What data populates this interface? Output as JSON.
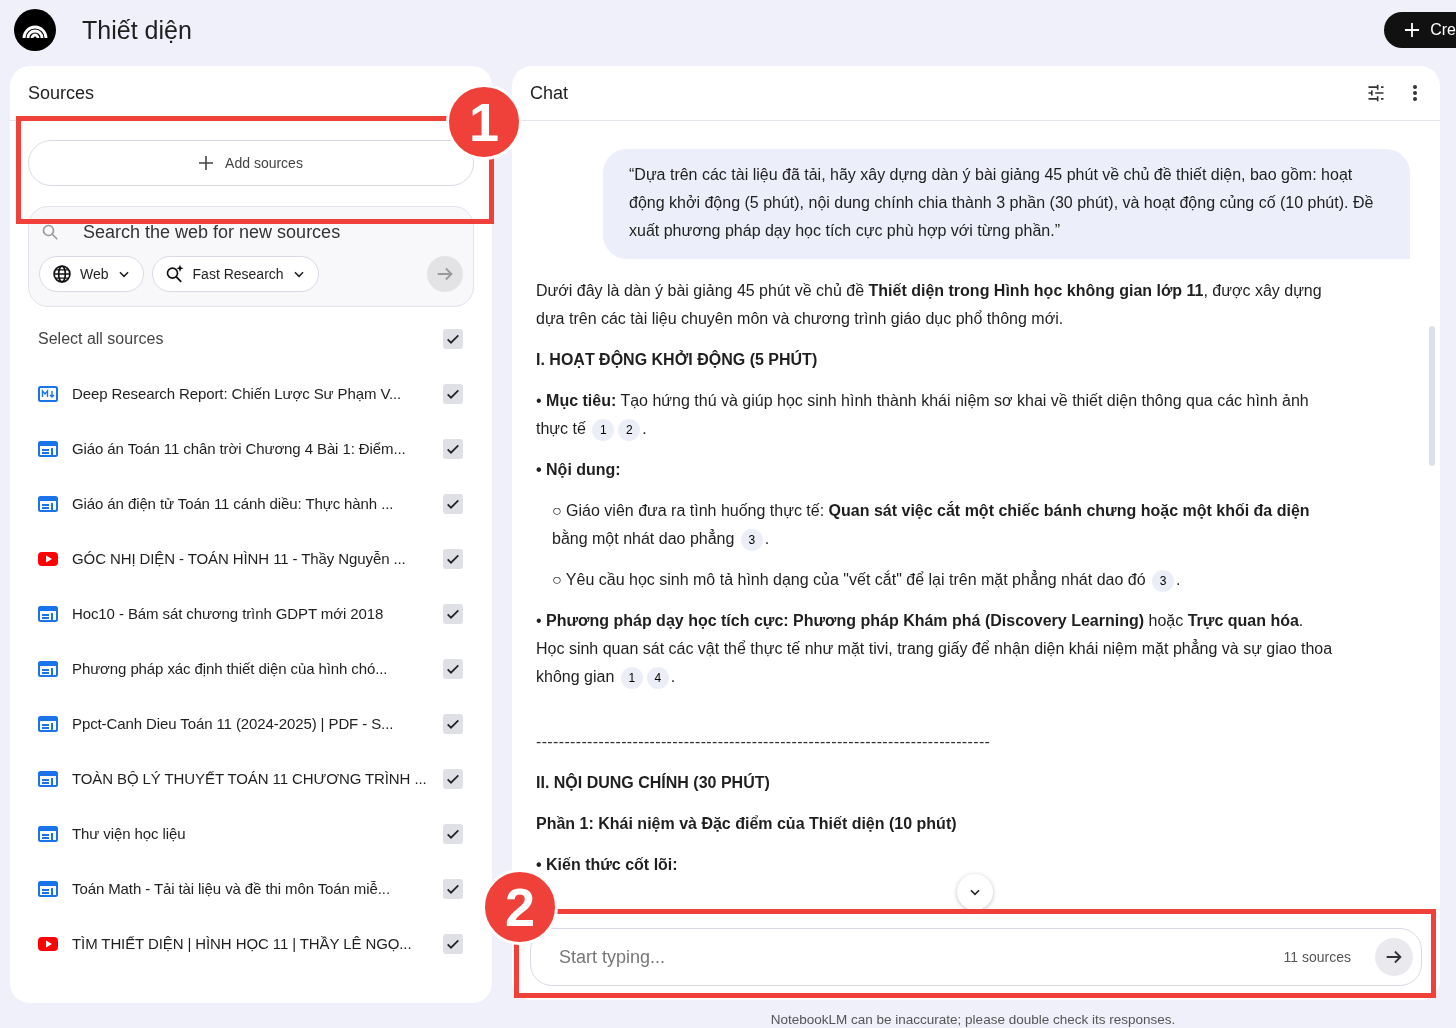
{
  "app": {
    "title": "Thiết diện",
    "create_button": "Cre"
  },
  "sources": {
    "title": "Sources",
    "add_button": "Add sources",
    "search": {
      "placeholder": "Search the web for new sources",
      "mode": "Web",
      "research": "Fast Research"
    },
    "select_all": {
      "label": "Select all sources",
      "checked": true
    },
    "items": [
      {
        "kind": "markdown",
        "title": "Deep Research Report: Chiến Lược Sư Phạm V...",
        "checked": true
      },
      {
        "kind": "web",
        "title": "Giáo án Toán 11 chân trời Chương 4 Bài 1: Điểm...",
        "checked": true
      },
      {
        "kind": "web",
        "title": "Giáo án điện tử Toán 11 cánh diều: Thực hành ...",
        "checked": true
      },
      {
        "kind": "youtube",
        "title": "GÓC NHỊ DIỆN - TOÁN HÌNH 11 - Thầy Nguyễn ...",
        "checked": true
      },
      {
        "kind": "web",
        "title": "Hoc10 - Bám sát chương trình GDPT mới 2018",
        "checked": true
      },
      {
        "kind": "web",
        "title": "Phương pháp xác định thiết diện của hình chó...",
        "checked": true
      },
      {
        "kind": "web",
        "title": "Ppct-Canh Dieu Toán 11 (2024-2025) | PDF - S...",
        "checked": true
      },
      {
        "kind": "web",
        "title": "TOÀN BỘ LÝ THUYẾT TOÁN 11 CHƯƠNG TRÌNH ...",
        "checked": true
      },
      {
        "kind": "web",
        "title": "Thư viện học liệu",
        "checked": true
      },
      {
        "kind": "web",
        "title": "Toán Math - Tải tài liệu và đề thi môn Toán miễ...",
        "checked": true
      },
      {
        "kind": "youtube",
        "title": "TÌM THIẾT DIỆN | HÌNH HỌC 11 | THẦY LÊ NGỌ...",
        "checked": true
      }
    ]
  },
  "chat": {
    "title": "Chat",
    "user_message": "“Dựa trên các tài liệu đã tải, hãy xây dựng dàn ý bài giảng 45 phút về chủ đề thiết diện, bao gồm: hoạt động khởi động (5 phút), nội dung chính chia thành 3 phần (30 phút), và hoạt động củng cố (10 phút). Đề xuất phương pháp dạy học tích cực phù hợp với từng phần.”",
    "response": [
      {
        "kind": "paragraph",
        "text": "Dưới đây là dàn ý bài giảng 45 phút về chủ đề **Thiết diện trong Hình học không gian lớp 11**, được xây dựng dựa trên các tài liệu chuyên môn và chương trình giáo dục phổ thông mới."
      },
      {
        "kind": "heading",
        "text": "I. HOẠT ĐỘNG KHỞI ĐỘNG (5 PHÚT)"
      },
      {
        "kind": "paragraph",
        "text": "• **Mục tiêu:** Tạo hứng thú và giúp học sinh hình thành khái niệm sơ khai về thiết diện thông qua các hình ảnh thực tế",
        "citations": [
          "1",
          "2"
        ],
        "end": "."
      },
      {
        "kind": "heading",
        "text": "• Nội dung:"
      },
      {
        "kind": "subbullet",
        "text": "○ Giáo viên đưa ra tình huống thực tế: **Quan sát việc cắt một chiếc bánh chưng hoặc một khối đa diện** bằng một nhát dao phẳng",
        "citations": [
          "3"
        ],
        "end": "."
      },
      {
        "kind": "subbullet",
        "text": "○ Yêu cầu học sinh mô tả hình dạng của \"vết cắt\" để lại trên mặt phẳng nhát dao đó",
        "citations": [
          "3"
        ],
        "end": "."
      },
      {
        "kind": "paragraph",
        "text": "• **Phương pháp dạy học tích cực: Phương pháp Khám phá (Discovery Learning)** hoặc **Trực quan hóa**. Học sinh quan sát các vật thể thực tế như mặt tivi, trang giấy để nhận diện khái niệm mặt phẳng và sự giao thoa không gian",
        "citations": [
          "1",
          "4"
        ],
        "end": "."
      },
      {
        "kind": "divider",
        "text": "--------------------------------------------------------------------------------"
      },
      {
        "kind": "heading",
        "text": "II. NỘI DUNG CHÍNH (30 PHÚT)"
      },
      {
        "kind": "heading",
        "text": "Phần 1: Khái niệm và Đặc điểm của Thiết diện (10 phút)"
      },
      {
        "kind": "heading",
        "text": "• Kiến thức cốt lõi:"
      }
    ],
    "input": {
      "placeholder": "Start typing...",
      "source_count": "11 sources"
    },
    "disclaimer": "NotebookLM can be inaccurate; please double check its responses."
  },
  "annotations": [
    {
      "label": "1"
    },
    {
      "label": "2"
    }
  ]
}
